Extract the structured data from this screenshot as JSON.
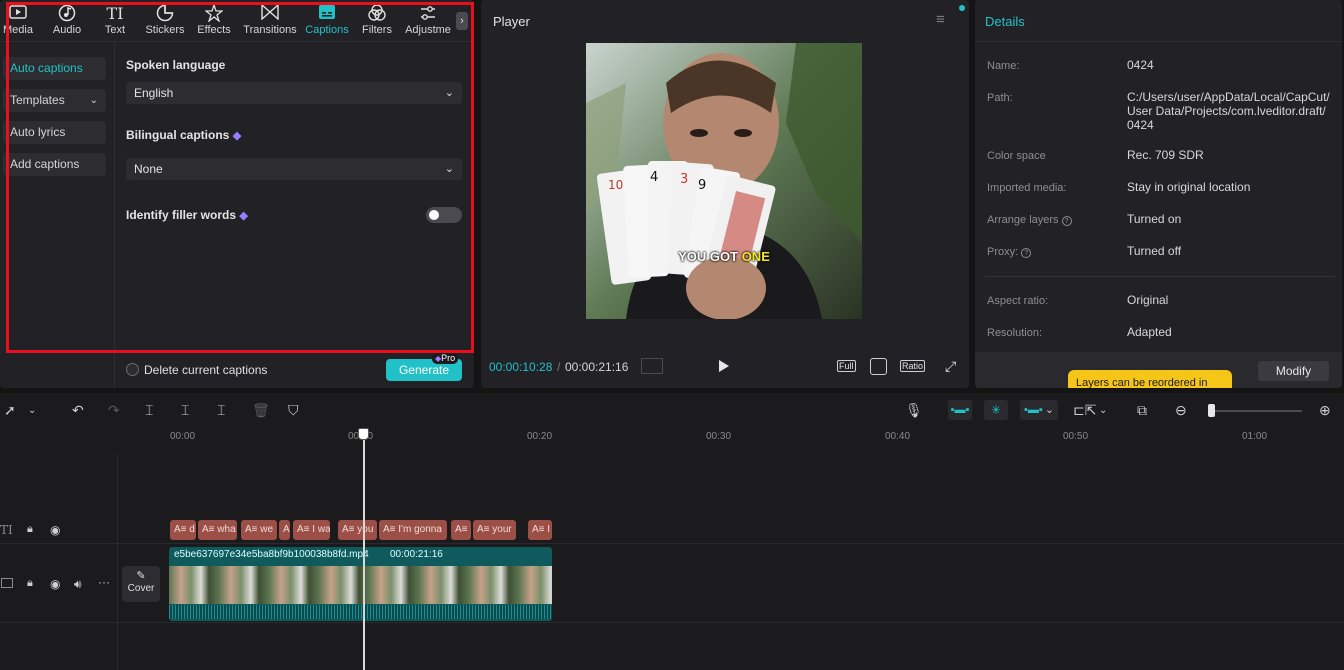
{
  "colors": {
    "accent": "#22c1c8",
    "highlight_box": "#e8101d",
    "caption_clip": "#9b4f46",
    "video_clip": "#0e5a5c",
    "tooltip": "#f5c518"
  },
  "tabs": [
    {
      "label": "Media",
      "icon": "media-icon"
    },
    {
      "label": "Audio",
      "icon": "audio-icon"
    },
    {
      "label": "Text",
      "icon": "text-icon"
    },
    {
      "label": "Stickers",
      "icon": "sticker-icon"
    },
    {
      "label": "Effects",
      "icon": "effects-icon"
    },
    {
      "label": "Transitions",
      "icon": "transition-icon"
    },
    {
      "label": "Captions",
      "icon": "captions-icon"
    },
    {
      "label": "Filters",
      "icon": "filters-icon"
    },
    {
      "label": "Adjustme",
      "icon": "adjust-icon"
    }
  ],
  "side": {
    "auto_captions": "Auto captions",
    "templates": "Templates",
    "auto_lyrics": "Auto lyrics",
    "add_captions": "Add captions"
  },
  "captions": {
    "spoken_language_label": "Spoken language",
    "spoken_language_value": "English",
    "bilingual_label": "Bilingual captions",
    "bilingual_value": "None",
    "filler_label": "Identify filler words",
    "filler_enabled": false,
    "delete_label": "Delete current captions",
    "generate_label": "Generate",
    "pro_badge": "Pro"
  },
  "player": {
    "title": "Player",
    "caption_text_1": "YOU GOT ",
    "caption_text_2": "ONE",
    "current_time": "00:00:10:28",
    "total_time": "00:00:21:16",
    "full_label": "Full",
    "ratio_label": "Ratio"
  },
  "details": {
    "title": "Details",
    "rows": [
      {
        "k": "Name:",
        "v": "0424"
      },
      {
        "k": "Path:",
        "v": "C:/Users/user/AppData/Local/CapCut/ User Data/Projects/com.lveditor.draft/ 0424"
      },
      {
        "k": "Color space",
        "v": "Rec. 709 SDR"
      },
      {
        "k": "Imported media:",
        "v": "Stay in original location"
      },
      {
        "k": "Arrange layers",
        "v": "Turned on"
      },
      {
        "k": "Proxy:",
        "v": "Turned off"
      },
      {
        "k": "Aspect ratio:",
        "v": "Original"
      },
      {
        "k": "Resolution:",
        "v": "Adapted"
      }
    ],
    "tooltip": "Layers can be reordered in",
    "modify_label": "Modify"
  },
  "timeline": {
    "ruler": [
      "00:00",
      "00:10",
      "00:20",
      "00:30",
      "00:40",
      "00:50",
      "01:00"
    ],
    "caption_clips": [
      "A≡ d",
      "A≡ wha",
      "A≡ we",
      "A≡",
      "A≡ I wa",
      "A≡ you",
      "A≡ I'm gonna",
      "A≡",
      "A≡ your",
      "A≡ I"
    ],
    "video_name": "e5be637697e34e5ba8bf9b100038b8fd.mp4",
    "video_duration": "00:00:21:16",
    "cover_label": "Cover",
    "track_text_icon": "TI"
  }
}
